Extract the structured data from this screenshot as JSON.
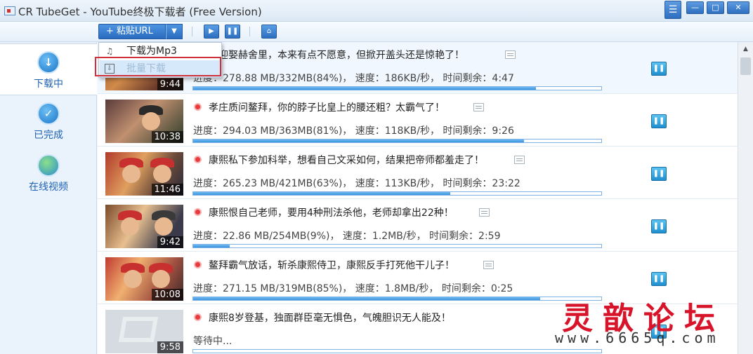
{
  "window": {
    "title": "CR TubeGet - YouTube终极下载者 (Free Version)",
    "controls": {
      "menu": "☰",
      "minimize": "—",
      "maximize": "□",
      "close": "✕"
    }
  },
  "toolbar": {
    "paste_label": "+ 粘贴URL",
    "dropdown_arrow": "▼",
    "play_glyph": "▶",
    "pause_glyph": "❚❚",
    "trash_glyph": "⌂"
  },
  "dropdown": {
    "items": [
      {
        "label": "下载为Mp3",
        "icon": "music-icon",
        "glyph": "♫"
      },
      {
        "label": "批量下载",
        "icon": "batch-download-icon",
        "glyph": "⇩"
      }
    ]
  },
  "sidebar": {
    "items": [
      {
        "label": "下载中",
        "icon": "download-icon",
        "glyph": "↓"
      },
      {
        "label": "已完成",
        "icon": "check-icon",
        "glyph": "✓"
      },
      {
        "label": "在线视频",
        "icon": "globe-icon",
        "glyph": ""
      }
    ]
  },
  "downloads": [
    {
      "title": "熙迎娶赫舍里，本来有点不愿意，但掀开盖头还是惊艳了！",
      "duration": "9:44",
      "progress_text": "进度：278.88 MB/332MB(84%)， 速度：186KB/秒， 时间剩余：4:47",
      "progress": 0.84
    },
    {
      "title": "孝庄质问鳌拜，你的脖子比皇上的腰还粗？太霸气了！",
      "duration": "10:38",
      "progress_text": "进度：294.03 MB/363MB(81%)， 速度：118KB/秒， 时间剩余：9:26",
      "progress": 0.81
    },
    {
      "title": "康熙私下参加科举，想看自己文采如何，结果把帝师都羞走了！",
      "duration": "11:46",
      "progress_text": "进度：265.23 MB/421MB(63%)， 速度：113KB/秒， 时间剩余：23:22",
      "progress": 0.63
    },
    {
      "title": "康熙恨自己老师，要用4种刑法杀他，老师却拿出22种！",
      "duration": "9:42",
      "progress_text": "进度：22.86 MB/254MB(9%)， 速度：1.2MB/秒， 时间剩余：2:59",
      "progress": 0.09
    },
    {
      "title": "鳌拜霸气放话，斩杀康熙侍卫，康熙反手打死他干儿子！",
      "duration": "10:08",
      "progress_text": "进度：271.15 MB/319MB(85%)， 速度：1.8MB/秒， 时间剩余：0:25",
      "progress": 0.85
    },
    {
      "title": "康熙8岁登基，独面群臣毫无惧色，气魄胆识无人能及！",
      "duration": "9:58",
      "progress_text": "等待中...",
      "progress": 0
    }
  ],
  "row_pause_glyph": "❚❚",
  "scrollbar": {
    "up": "▲"
  },
  "watermark": {
    "title": "灵歆论坛",
    "url": "www.6665q.com"
  },
  "colors": {
    "accent": "#2a6bbf",
    "highlight_border": "#d0303a",
    "watermark": "#d8142a"
  }
}
